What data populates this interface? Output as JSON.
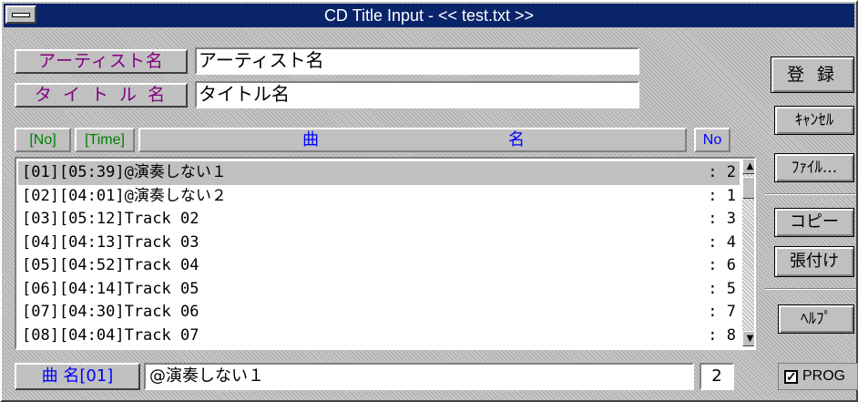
{
  "window": {
    "title": "CD Title Input - << test.txt >>"
  },
  "fields": {
    "artist_label": "アーティスト名",
    "artist_value": "アーティスト名",
    "title_label": "タ イ ト ル 名",
    "title_value": "タイトル名"
  },
  "side_buttons": {
    "register": "登 録",
    "cancel": "ｷｬﾝｾﾙ",
    "file": "ﾌｧｲﾙ...",
    "copy": "コピー",
    "paste": "張付け",
    "help": "ﾍﾙﾌﾟ"
  },
  "list_header": {
    "no": "[No]",
    "time": "[Time]",
    "song_part1": "曲",
    "song_part2": "名",
    "order": "No"
  },
  "tracks": [
    {
      "text": "[01][05:39]@演奏しない１",
      "num": ": 2"
    },
    {
      "text": "[02][04:01]@演奏しない２",
      "num": ": 1"
    },
    {
      "text": "[03][05:12]Track 02",
      "num": ": 3"
    },
    {
      "text": "[04][04:13]Track 03",
      "num": ": 4"
    },
    {
      "text": "[05][04:52]Track 04",
      "num": ": 6"
    },
    {
      "text": "[06][04:14]Track 05",
      "num": ": 5"
    },
    {
      "text": "[07][04:30]Track 06",
      "num": ": 7"
    },
    {
      "text": "[08][04:04]Track 07",
      "num": ": 8"
    }
  ],
  "selected_track": 0,
  "scrollbar": {
    "up_icon": "arrow-up-icon",
    "down_icon": "arrow-down-icon"
  },
  "editor": {
    "label": "曲 名[01]",
    "song_value": "@演奏しない１",
    "order_value": "2"
  },
  "prog": {
    "label": "PROG",
    "checked": true
  }
}
